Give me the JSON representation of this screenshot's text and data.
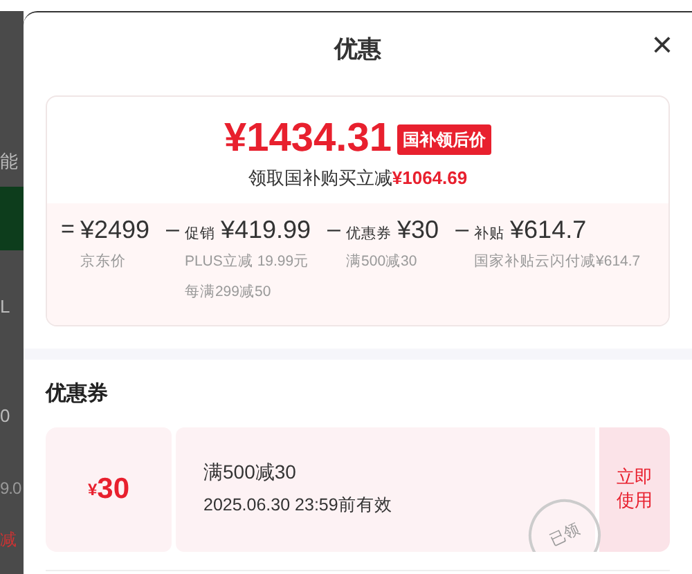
{
  "background_fragments": [
    {
      "text": "能",
      "kind": "plain"
    },
    {
      "text": "L",
      "kind": "plain"
    },
    {
      "text": "0",
      "kind": "plain"
    },
    {
      "text": "9.0",
      "kind": "muted"
    },
    {
      "text": "减",
      "kind": "red"
    }
  ],
  "sheet": {
    "title": "优惠",
    "close": "×"
  },
  "summary": {
    "price": "¥1434.31",
    "badge": "国补领后价",
    "subline": "领取国补购买立减**¥1064.69**",
    "breakdown": [
      {
        "operator": "=",
        "amount": "¥2499",
        "notes": [
          "京东价"
        ]
      },
      {
        "operator": "–",
        "label": "促销",
        "amount": "¥419.99",
        "notes": [
          "PLUS立减 19.99元",
          "每满299减50"
        ]
      },
      {
        "operator": "–",
        "label": "优惠券",
        "amount": "¥30",
        "notes": [
          "满500减30"
        ]
      },
      {
        "operator": "–",
        "label": "补贴",
        "amount": "¥614.7",
        "notes": [
          "国家补贴云闪付减¥614.7"
        ]
      }
    ]
  },
  "coupons_heading": "优惠券",
  "coupons": [
    {
      "currency": "¥",
      "amount": "30",
      "condition": "满500减30",
      "validity": "2025.06.30 23:59前有效",
      "claimed": true,
      "stamp": "已领",
      "action": "立即使用"
    }
  ]
}
